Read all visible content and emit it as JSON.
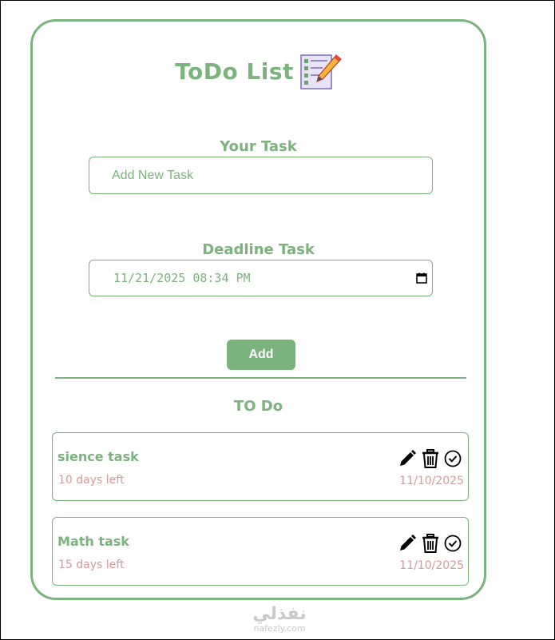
{
  "app": {
    "title": "ToDo List",
    "logo_icon": "notepad-pencil-icon"
  },
  "form": {
    "task_label": "Your Task",
    "task_placeholder": "Add New Task",
    "deadline_label": "Deadline Task",
    "deadline_value": "11/21/2025 08:34 PM",
    "add_button": "Add"
  },
  "list": {
    "title": "TO Do",
    "tasks": [
      {
        "name": "sience task",
        "remaining": "10 days left",
        "date": "11/10/2025"
      },
      {
        "name": "Math task",
        "remaining": "15 days left",
        "date": "11/10/2025"
      }
    ]
  },
  "watermark": {
    "arabic": "نفذلي",
    "domain": "nafezly.com"
  },
  "colors": {
    "accent": "#7bb37c",
    "deadline": "#d79a9a"
  }
}
